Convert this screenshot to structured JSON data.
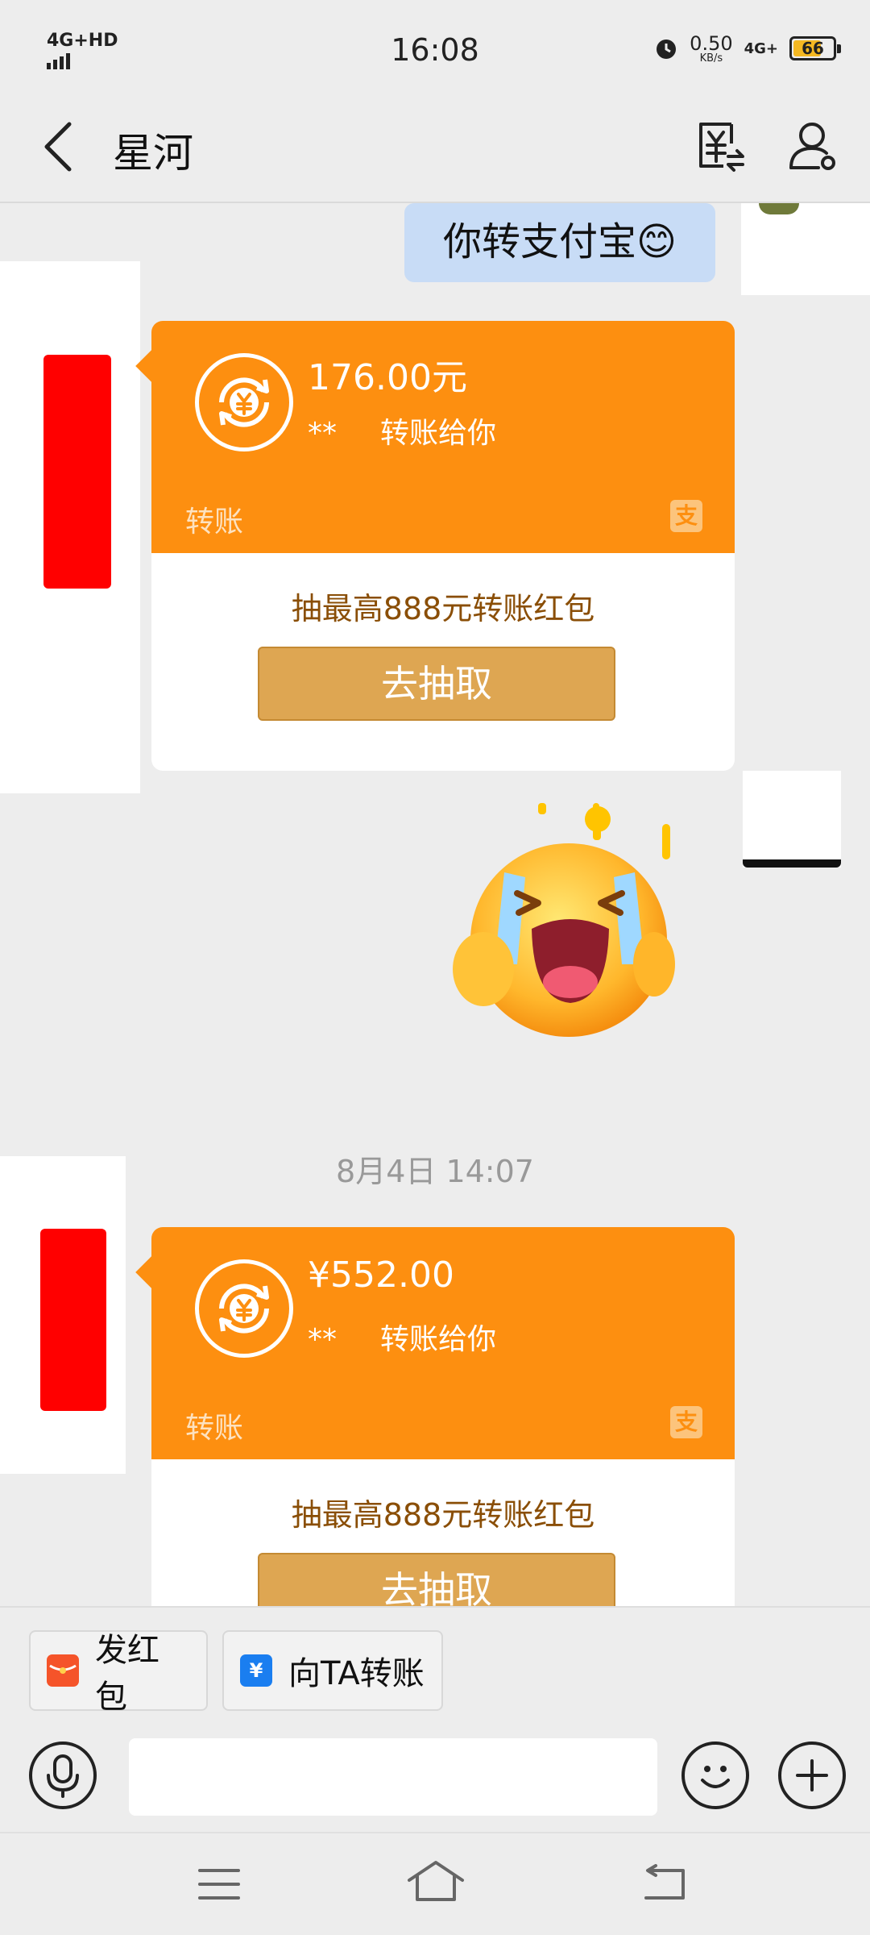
{
  "status_bar": {
    "network": "4G+HD",
    "time": "16:08",
    "speed_value": "0.50",
    "speed_unit": "KB/s",
    "network2": "4G+",
    "battery": "66",
    "battery_level": 0.66
  },
  "nav": {
    "title": "星河"
  },
  "chat": {
    "outgoing_text": "你转支付宝😊",
    "transfers": [
      {
        "amount": "176.00元",
        "sender": "**",
        "action": "转账给你",
        "label": "转账",
        "promo": "抽最高888元转账红包",
        "button": "去抽取"
      },
      {
        "amount": "¥552.00",
        "sender": "**",
        "action": "转账给你",
        "label": "转账",
        "promo": "抽最高888元转账红包",
        "button": "去抽取"
      }
    ],
    "timestamp": "8月4日 14:07",
    "alipay_glyph": "支"
  },
  "quick_actions": {
    "red_packet": "发红包",
    "transfer_to": "向TA转账"
  },
  "input": {
    "placeholder": ""
  },
  "colors": {
    "transfer_orange": "#fd8f10",
    "outgoing_bubble": "#c8dcf6",
    "button_gold": "#dea652",
    "redacted_red": "#ff0000"
  }
}
